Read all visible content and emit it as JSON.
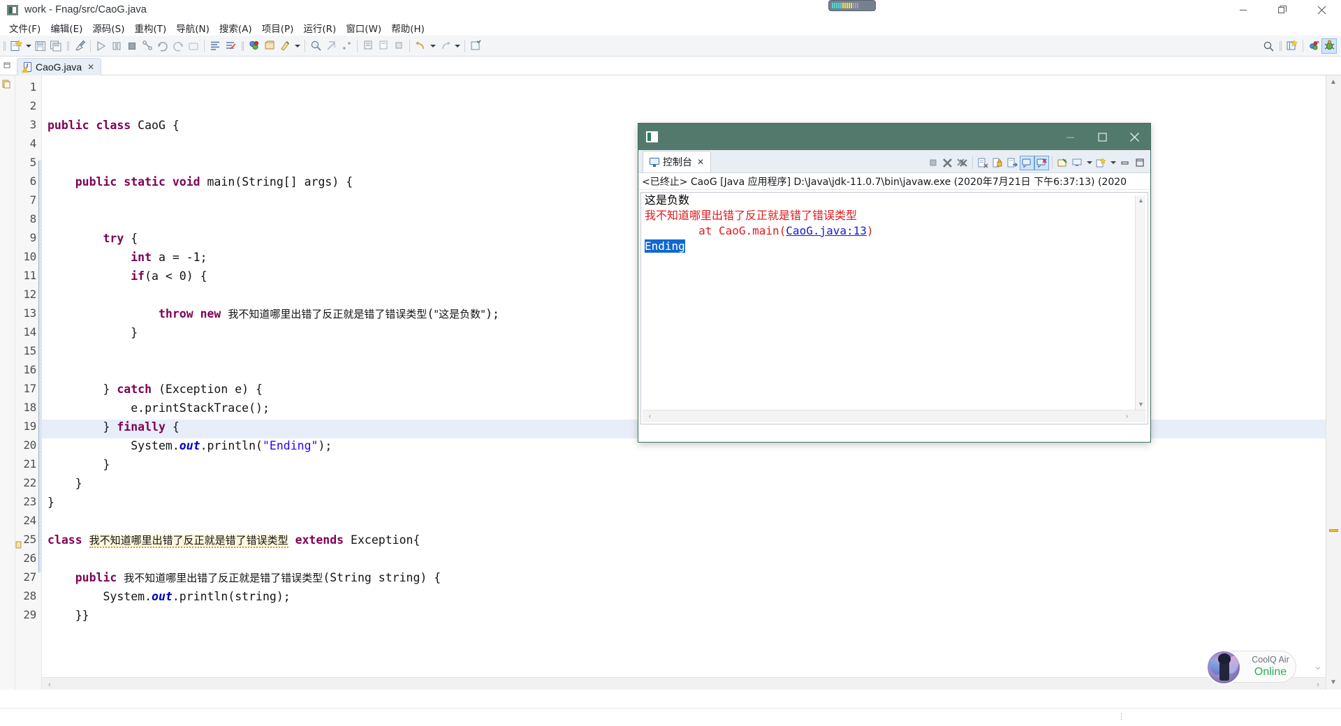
{
  "window": {
    "title": "work - Fnag/src/CaoG.java",
    "icon": "eclipse-window-icon",
    "controls": {
      "minimize": "minimize-icon",
      "maximize": "restore-icon",
      "close": "close-icon"
    }
  },
  "menubar": {
    "items": [
      {
        "label": "文件(F)",
        "name": "menu-file"
      },
      {
        "label": "编辑(E)",
        "name": "menu-edit"
      },
      {
        "label": "源码(S)",
        "name": "menu-source"
      },
      {
        "label": "重构(T)",
        "name": "menu-refactor"
      },
      {
        "label": "导航(N)",
        "name": "menu-navigate"
      },
      {
        "label": "搜索(A)",
        "name": "menu-search"
      },
      {
        "label": "项目(P)",
        "name": "menu-project"
      },
      {
        "label": "运行(R)",
        "name": "menu-run"
      },
      {
        "label": "窗口(W)",
        "name": "menu-window"
      },
      {
        "label": "帮助(H)",
        "name": "menu-help"
      }
    ]
  },
  "toolbar": {
    "icons": [
      "new-wizard-icon",
      "new-dropdown-icon",
      "save-icon",
      "save-all-icon",
      "print-icon",
      "run-icon",
      "debug-step-icon",
      "terminate-icon",
      "coverage-icon",
      "run-last-icon",
      "debug-last-icon",
      "external-tools-icon",
      "toggle-markoccurrences-icon",
      "skip-breakpoints-icon",
      "new-java-project-icon",
      "new-package-icon",
      "new-class-icon",
      "new-class-dropdown-icon",
      "open-type-icon",
      "search-icon",
      "link-icon",
      "next-annotation-icon",
      "previous-annotation-icon",
      "last-edit-icon",
      "back-icon",
      "back-dropdown-icon",
      "forward-icon",
      "forward-dropdown-icon",
      "pin-editor-icon"
    ],
    "right_icons": [
      "quick-access-search-icon",
      "open-perspective-icon",
      "java-perspective-icon",
      "debug-perspective-icon"
    ]
  },
  "editor": {
    "tab": {
      "filename": "CaoG.java",
      "dirty": false,
      "has_warning": true,
      "close": "✕"
    },
    "restore_icon": "restore-editor-icon",
    "highlighted_line": 20,
    "lines": [
      {
        "n": 1,
        "indent": 0,
        "tokens": []
      },
      {
        "n": 2,
        "indent": 0,
        "tokens": []
      },
      {
        "n": 3,
        "indent": 0,
        "text": "public class CaoG {"
      },
      {
        "n": 4,
        "indent": 0,
        "text": ""
      },
      {
        "n": 5,
        "indent": 0,
        "text": ""
      },
      {
        "n": 6,
        "indent": 0,
        "text": "    public static void main(String[] args) {"
      },
      {
        "n": 7,
        "indent": 0,
        "text": ""
      },
      {
        "n": 8,
        "indent": 0,
        "text": ""
      },
      {
        "n": 9,
        "indent": 0,
        "text": "        try {"
      },
      {
        "n": 10,
        "indent": 0,
        "text": "            int a = -1;"
      },
      {
        "n": 11,
        "indent": 0,
        "text": "            if(a < 0) {"
      },
      {
        "n": 12,
        "indent": 0,
        "text": ""
      },
      {
        "n": 13,
        "indent": 0,
        "text": "                throw new 我不知道哪里出错了反正就是错了错误类型(\"这是负数\");"
      },
      {
        "n": 14,
        "indent": 0,
        "text": "            }"
      },
      {
        "n": 15,
        "indent": 0,
        "text": ""
      },
      {
        "n": 16,
        "indent": 0,
        "text": ""
      },
      {
        "n": 17,
        "indent": 0,
        "text": "        } catch (Exception e) {"
      },
      {
        "n": 18,
        "indent": 0,
        "text": "            e.printStackTrace();"
      },
      {
        "n": 19,
        "indent": 0,
        "text": "        } finally {"
      },
      {
        "n": 20,
        "indent": 0,
        "text": "            System.out.println(\"Ending\");"
      },
      {
        "n": 21,
        "indent": 0,
        "text": "        }"
      },
      {
        "n": 22,
        "indent": 0,
        "text": "    }"
      },
      {
        "n": 23,
        "indent": 0,
        "text": "}"
      },
      {
        "n": 24,
        "indent": 0,
        "text": ""
      },
      {
        "n": 25,
        "indent": 0,
        "text": "class 我不知道哪里出错了反正就是错了错误类型 extends Exception{"
      },
      {
        "n": 26,
        "indent": 0,
        "text": ""
      },
      {
        "n": 27,
        "indent": 0,
        "text": "    public 我不知道哪里出错了反正就是错了错误类型(String string) {"
      },
      {
        "n": 28,
        "indent": 0,
        "text": "        System.out.println(string);"
      },
      {
        "n": 29,
        "indent": 0,
        "text": "    }}"
      }
    ],
    "line_numbers": [
      "1",
      "2",
      "3",
      "4",
      "5",
      "6",
      "7",
      "8",
      "9",
      "10",
      "11",
      "12",
      "13",
      "14",
      "15",
      "16",
      "17",
      "18",
      "19",
      "20",
      "21",
      "22",
      "23",
      "24",
      "25",
      "26",
      "27",
      "28",
      "29"
    ],
    "code": {
      "l3_kw1": "public",
      "l3_kw2": "class",
      "l3_name": "CaoG",
      "l3_brace": "{",
      "l6_kw1": "public",
      "l6_kw2": "static",
      "l6_kw3": "void",
      "l6_main": "main(String[] args) {",
      "l9_try": "try",
      "l9_brace": "{",
      "l10_int": "int",
      "l10_rest": " a = -1;",
      "l11_if": "if",
      "l11_rest": "(a < 0) {",
      "l13_throw": "throw",
      "l13_new": "new",
      "l13_cls": "我不知道哪里出错了反正就是错了错误类型",
      "l13_open": "(",
      "l13_str": "\"这是负数\"",
      "l13_end": ");",
      "l14_brace": "}",
      "l17_cbrace": "}",
      "l17_catch": "catch",
      "l17_rest": " (Exception e) {",
      "l18_text": "e.printStackTrace();",
      "l19_cbrace": "}",
      "l19_finally": "finally",
      "l19_brace": "{",
      "l20_sys": "System.",
      "l20_out": "out",
      "l20_println": ".println(",
      "l20_str": "\"Ending\"",
      "l20_end": ");",
      "l21_brace": "}",
      "l22_brace": "}",
      "l23_brace": "}",
      "l25_class": "class",
      "l25_name": "我不知道哪里出错了反正就是错了错误类型",
      "l25_extends": "extends",
      "l25_exc": "Exception{",
      "l27_public": "public",
      "l27_name": "我不知道哪里出错了反正就是错了错误类型",
      "l27_args": "(String string) {",
      "l28_sys": "System.",
      "l28_out": "out",
      "l28_rest": ".println(string);",
      "l29_brace": "}}"
    }
  },
  "console_window": {
    "title_icon": "console-window-icon",
    "controls": {
      "minimize": "minimize-icon",
      "maximize": "maximize-icon",
      "close": "close-icon"
    },
    "tab": {
      "label": "控制台",
      "icon": "console-icon",
      "close": "✕"
    },
    "toolbar_icons": [
      "terminate-icon",
      "remove-launch-icon",
      "remove-all-launches-icon",
      "clear-console-icon",
      "scroll-lock-icon",
      "show-console-on-output-icon",
      "pin-console-icon",
      "display-selected-console-icon",
      "open-console-icon",
      "open-console-dropdown-icon",
      "new-console-view-icon",
      "new-console-dropdown-icon",
      "minimize-view-icon",
      "maximize-view-icon"
    ],
    "status_line": "<已终止> CaoG [Java 应用程序] D:\\Java\\jdk-11.0.7\\bin\\javaw.exe  (2020年7月21日 下午6:37:13)   (2020",
    "output": [
      {
        "text": "这是负数",
        "kind": "stdout-cjk"
      },
      {
        "text": "我不知道哪里出错了反正就是错了错误类型",
        "kind": "stderr-cjk"
      },
      {
        "text": "        at CaoG.main(",
        "link": "CaoG.java:13",
        "suffix": ")",
        "kind": "stderr-trace"
      },
      {
        "text": "Ending",
        "kind": "stdout-selected"
      }
    ],
    "scroll": {
      "up": "▲",
      "down": "▼",
      "left": "‹",
      "right": "›"
    }
  },
  "coolq": {
    "name": "CoolQ Air",
    "status": "Online",
    "avatar": "coolq-avatar",
    "chevron": "chevron-down-icon"
  },
  "colors": {
    "console_title_bg": "#53796d",
    "keyword": "#7f0055",
    "string": "#2a00ff",
    "field": "#0000c0",
    "error_red": "#e01b1b",
    "selection_blue": "#1168cf",
    "link_blue": "#1a1ad0",
    "highlight_line": "#e8eef9"
  }
}
